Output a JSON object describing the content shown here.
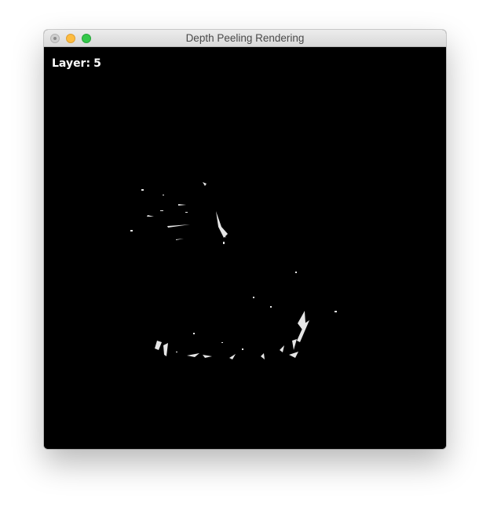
{
  "window": {
    "title": "Depth Peeling Rendering",
    "controls": [
      "close",
      "minimize",
      "maximize"
    ]
  },
  "overlay": {
    "layer_label": "Layer:",
    "layer_value": "5"
  },
  "colors": {
    "background": "#000000",
    "fragment": "#e6e6e6",
    "close": "#cfcfcf",
    "minimize": "#fdbc40",
    "maximize": "#34c84a"
  }
}
